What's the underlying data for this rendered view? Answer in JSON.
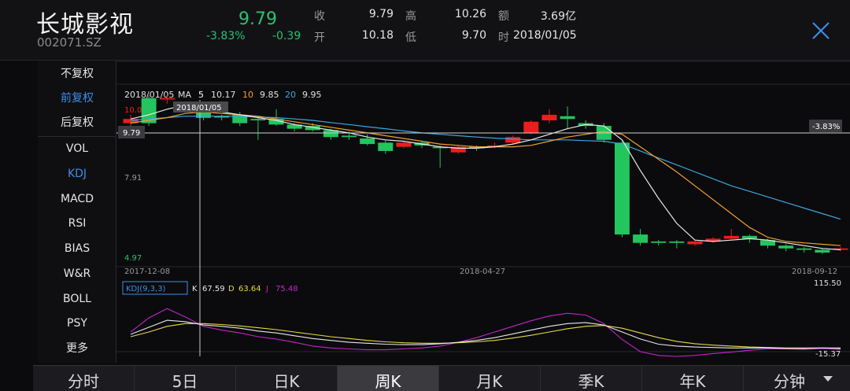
{
  "header": {
    "name": "长城影视",
    "code": "002071.SZ",
    "price": "9.79",
    "change_pct": "-3.83%",
    "change": "-0.39",
    "quote": [
      {
        "label": "收",
        "value": "9.79"
      },
      {
        "label": "高",
        "value": "10.26"
      },
      {
        "label": "额",
        "value": "3.69亿"
      },
      {
        "label": "开",
        "value": "10.18"
      },
      {
        "label": "低",
        "value": "9.70"
      },
      {
        "label": "时",
        "value": "2018/01/05"
      }
    ]
  },
  "sidebar": {
    "items": [
      {
        "label": "不复权",
        "active": false
      },
      {
        "label": "前复权",
        "active": true
      },
      {
        "label": "后复权",
        "active": false
      },
      {
        "label": "VOL",
        "active": false
      },
      {
        "label": "KDJ",
        "active": true
      },
      {
        "label": "MACD",
        "active": false
      },
      {
        "label": "RSI",
        "active": false
      },
      {
        "label": "BIAS",
        "active": false
      },
      {
        "label": "W&R",
        "active": false
      },
      {
        "label": "BOLL",
        "active": false
      },
      {
        "label": "PSY",
        "active": false
      },
      {
        "label": "更多",
        "active": false
      }
    ]
  },
  "tabs": [
    {
      "label": "分时",
      "active": false
    },
    {
      "label": "5日",
      "active": false
    },
    {
      "label": "日K",
      "active": false
    },
    {
      "label": "周K",
      "active": true
    },
    {
      "label": "月K",
      "active": false
    },
    {
      "label": "季K",
      "active": false
    },
    {
      "label": "年K",
      "active": false
    },
    {
      "label": "分钟",
      "active": false
    }
  ],
  "colors": {
    "up": "#f01c1c",
    "down": "#22c55e",
    "ma5": "#ffffff",
    "ma10": "#f0a030",
    "ma20": "#3ba7e0",
    "k": "#e8e8e8",
    "d": "#e6d84a",
    "j": "#c026c9",
    "accent": "#3f8ee8"
  },
  "chart_data": {
    "type": "candlestick",
    "ma_legend": {
      "date": "2018/01/05",
      "label": "MA",
      "items": [
        {
          "period": "5",
          "value": "10.17"
        },
        {
          "period": "10",
          "value": "9.85"
        },
        {
          "period": "20",
          "value": "9.95"
        }
      ]
    },
    "crosshair_date": "2018/01/05",
    "current_price_label": "9.79",
    "current_pct_label": "-3.83%",
    "y_labels": {
      "top": "10.00",
      "mid": "7.91",
      "bottom": "4.97"
    },
    "x_labels": [
      "2017-12-08",
      "2018-04-27",
      "2018-09-12"
    ],
    "ylim": [
      4.5,
      11.0
    ],
    "candles": [
      [
        9.6,
        9.75,
        9.5,
        9.9
      ],
      [
        10.5,
        9.6,
        9.5,
        10.6
      ],
      [
        10.45,
        10.5,
        10.3,
        10.6
      ],
      [
        10.1,
        10.2,
        10.0,
        10.3
      ],
      [
        10.1,
        9.79,
        9.7,
        10.3
      ],
      [
        9.85,
        9.8,
        9.7,
        9.9
      ],
      [
        9.9,
        9.6,
        9.5,
        10.0
      ],
      [
        9.75,
        9.7,
        9.0,
        9.8
      ],
      [
        9.75,
        9.55,
        9.5,
        10.1
      ],
      [
        9.55,
        9.4,
        9.3,
        9.6
      ],
      [
        9.5,
        9.35,
        9.3,
        9.6
      ],
      [
        9.35,
        9.1,
        9.0,
        9.4
      ],
      [
        9.15,
        9.1,
        9.0,
        9.3
      ],
      [
        9.05,
        8.85,
        8.8,
        9.2
      ],
      [
        8.9,
        8.6,
        8.5,
        9.0
      ],
      [
        8.75,
        8.9,
        8.7,
        8.95
      ],
      [
        8.9,
        8.8,
        8.7,
        8.95
      ],
      [
        8.75,
        8.7,
        8.0,
        8.8
      ],
      [
        8.55,
        8.75,
        8.5,
        8.8
      ],
      [
        8.75,
        8.7,
        8.6,
        8.8
      ],
      [
        8.75,
        8.8,
        8.7,
        8.9
      ],
      [
        8.9,
        9.1,
        8.85,
        9.15
      ],
      [
        9.25,
        9.65,
        9.2,
        9.7
      ],
      [
        9.7,
        9.9,
        9.6,
        10.1
      ],
      [
        9.85,
        9.75,
        9.4,
        10.2
      ],
      [
        9.6,
        9.5,
        9.4,
        9.7
      ],
      [
        9.5,
        9.0,
        8.9,
        9.6
      ],
      [
        8.9,
        5.6,
        5.5,
        9.0
      ],
      [
        5.6,
        5.3,
        5.2,
        5.8
      ],
      [
        5.35,
        5.3,
        5.2,
        5.4
      ],
      [
        5.35,
        5.3,
        5.1,
        5.4
      ],
      [
        5.25,
        5.35,
        5.2,
        5.4
      ],
      [
        5.35,
        5.45,
        5.3,
        5.5
      ],
      [
        5.45,
        5.55,
        5.4,
        5.8
      ],
      [
        5.55,
        5.45,
        5.3,
        5.6
      ],
      [
        5.4,
        5.2,
        5.1,
        5.45
      ],
      [
        5.2,
        5.1,
        5.0,
        5.25
      ],
      [
        5.1,
        5.05,
        4.95,
        5.15
      ],
      [
        5.05,
        4.95,
        4.9,
        5.1
      ],
      [
        5.05,
        5.1,
        5.0,
        5.15
      ]
    ],
    "ma_series": {
      "ma5": [
        9.75,
        9.9,
        10.1,
        10.25,
        10.1,
        10.0,
        9.9,
        9.8,
        9.7,
        9.55,
        9.45,
        9.35,
        9.25,
        9.1,
        9.0,
        8.95,
        8.85,
        8.75,
        8.7,
        8.7,
        8.75,
        8.85,
        9.0,
        9.2,
        9.4,
        9.55,
        9.5,
        9.0,
        7.9,
        6.9,
        6.0,
        5.4,
        5.35,
        5.4,
        5.45,
        5.4,
        5.3,
        5.2,
        5.1,
        5.05
      ],
      "ma10": [
        9.6,
        9.7,
        9.8,
        9.95,
        10.0,
        9.95,
        9.9,
        9.85,
        9.75,
        9.65,
        9.55,
        9.45,
        9.35,
        9.25,
        9.15,
        9.05,
        8.95,
        8.85,
        8.8,
        8.75,
        8.75,
        8.75,
        8.8,
        8.95,
        9.1,
        9.2,
        9.3,
        9.2,
        8.75,
        8.3,
        7.85,
        7.35,
        6.85,
        6.35,
        5.85,
        5.5,
        5.35,
        5.3,
        5.25,
        5.2
      ],
      "ma20": [
        9.7,
        9.75,
        9.8,
        9.85,
        9.85,
        9.85,
        9.85,
        9.82,
        9.8,
        9.75,
        9.7,
        9.62,
        9.55,
        9.47,
        9.4,
        9.32,
        9.25,
        9.2,
        9.15,
        9.1,
        9.06,
        9.03,
        9.0,
        9.0,
        9.0,
        8.97,
        8.95,
        8.85,
        8.6,
        8.35,
        8.1,
        7.85,
        7.6,
        7.35,
        7.15,
        6.95,
        6.75,
        6.55,
        6.35,
        6.15
      ]
    },
    "kdj_legend": {
      "title": "KDJ(9,3,3)",
      "items": [
        {
          "name": "K",
          "value": "67.59"
        },
        {
          "name": "D",
          "value": "63.64"
        },
        {
          "name": "J",
          "value": "75.48"
        }
      ]
    },
    "kdj_labels": {
      "top": "115.50",
      "bottom": "-15.37"
    },
    "kdj_ylim": [
      -15.37,
      115.5
    ],
    "kdj": {
      "K": [
        35,
        50,
        65,
        62,
        55,
        52,
        48,
        42,
        38,
        32,
        26,
        22,
        18,
        16,
        14,
        13,
        13,
        15,
        18,
        22,
        28,
        36,
        44,
        52,
        58,
        60,
        55,
        40,
        25,
        14,
        10,
        8,
        7,
        6,
        6,
        6,
        5,
        5,
        6,
        5
      ],
      "D": [
        30,
        40,
        52,
        58,
        58,
        56,
        53,
        49,
        45,
        40,
        35,
        30,
        26,
        22,
        19,
        17,
        16,
        16,
        17,
        19,
        22,
        27,
        33,
        40,
        47,
        52,
        54,
        48,
        38,
        28,
        20,
        15,
        12,
        10,
        8,
        7,
        6,
        6,
        6,
        6
      ],
      "J": [
        40,
        70,
        90,
        72,
        52,
        44,
        38,
        30,
        25,
        18,
        10,
        6,
        4,
        2,
        2,
        4,
        6,
        10,
        18,
        28,
        40,
        52,
        64,
        74,
        80,
        76,
        58,
        24,
        -2,
        -10,
        -12,
        -10,
        -6,
        -3,
        1,
        4,
        4,
        3,
        5,
        3
      ]
    }
  }
}
